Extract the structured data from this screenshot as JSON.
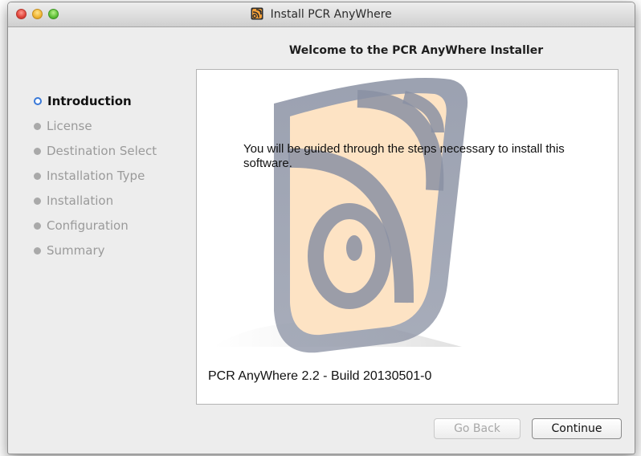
{
  "window": {
    "title": "Install PCR AnyWhere",
    "app_icon": "pcr-anywhere-logo-icon"
  },
  "header": {
    "welcome": "Welcome to the PCR AnyWhere Installer"
  },
  "steps": [
    {
      "label": "Introduction",
      "active": true
    },
    {
      "label": "License",
      "active": false
    },
    {
      "label": "Destination Select",
      "active": false
    },
    {
      "label": "Installation Type",
      "active": false
    },
    {
      "label": "Installation",
      "active": false
    },
    {
      "label": "Configuration",
      "active": false
    },
    {
      "label": "Summary",
      "active": false
    }
  ],
  "content": {
    "intro": "You will be guided through the steps necessary to install this software.",
    "build": "PCR AnyWhere 2.2 - Build 20130501-0"
  },
  "buttons": {
    "back": "Go Back",
    "continue": "Continue"
  },
  "colors": {
    "active_step": "#3a79d8",
    "logo_orange": "#f6a13a",
    "logo_gray": "#8a91a3"
  }
}
